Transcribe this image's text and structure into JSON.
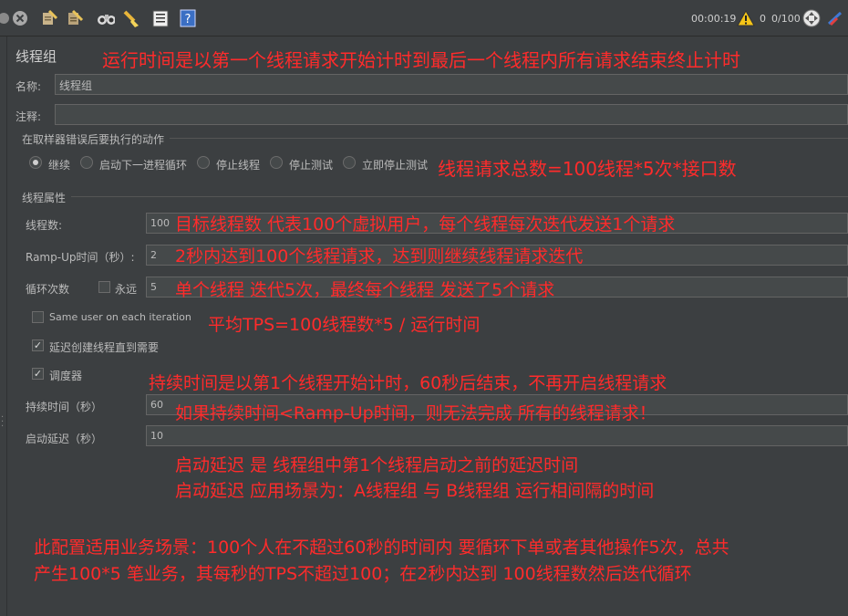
{
  "toolbar": {
    "icons": [
      "shutdown-icon",
      "clear-icon",
      "clear-all-icon",
      "broom-icon",
      "binoculars-icon",
      "reset-search-icon",
      "function-helper-icon",
      "help-icon"
    ],
    "timer": "00:00:19",
    "error_count": "0",
    "threads": "0/100"
  },
  "panel": {
    "title": "线程组",
    "name_label": "名称:",
    "name_value": "线程组",
    "comment_label": "注释:",
    "comment_value": "",
    "error_action": {
      "heading": "在取样器错误后要执行的动作",
      "options": [
        "继续",
        "启动下一进程循环",
        "停止线程",
        "停止测试",
        "立即停止测试"
      ],
      "selected": "继续"
    },
    "thread_props": {
      "heading": "线程属性",
      "threads_label": "线程数:",
      "threads_value": "100",
      "rampup_label": "Ramp-Up时间（秒）:",
      "rampup_value": "2",
      "loop_label": "循环次数",
      "forever_label": "永远",
      "loop_value": "5",
      "same_user_label": "Same user on each iteration",
      "delay_label": "延迟创建线程直到需要",
      "scheduler_label": "调度器",
      "duration_label": "持续时间（秒）",
      "duration_value": "60",
      "startup_label": "启动延迟（秒）",
      "startup_value": "10"
    }
  },
  "annotations": {
    "run_time": "运行时间是以第一个线程请求开始计时到最后一个线程内所有请求结束终止计时",
    "total_requests": "线程请求总数=100线程*5次*接口数",
    "threads_note": "目标线程数 代表100个虚拟用户，每个线程每次迭代发送1个请求",
    "rampup_note": "2秒内达到100个线程请求，达到则继续线程请求迭代",
    "loop_note": "单个线程 迭代5次，最终每个线程 发送了5个请求",
    "tps_note": "平均TPS=100线程数*5 / 运行时间",
    "duration_note": "持续时间是以第1个线程开始计时，60秒后结束，不再开启线程请求",
    "duration_warn": "如果持续时间<Ramp-Up时间，则无法完成 所有的线程请求！",
    "startup_note1": "启动延迟 是 线程组中第1个线程启动之前的延迟时间",
    "startup_note2": "启动延迟 应用场景为：A线程组 与 B线程组 运行相间隔的时间",
    "summary1": "此配置适用业务场景：100个人在不超过60秒的时间内 要循环下单或者其他操作5次，总共",
    "summary2": "产生100*5 笔业务，其每秒的TPS不超过100；在2秒内达到 100线程数然后迭代循环"
  }
}
